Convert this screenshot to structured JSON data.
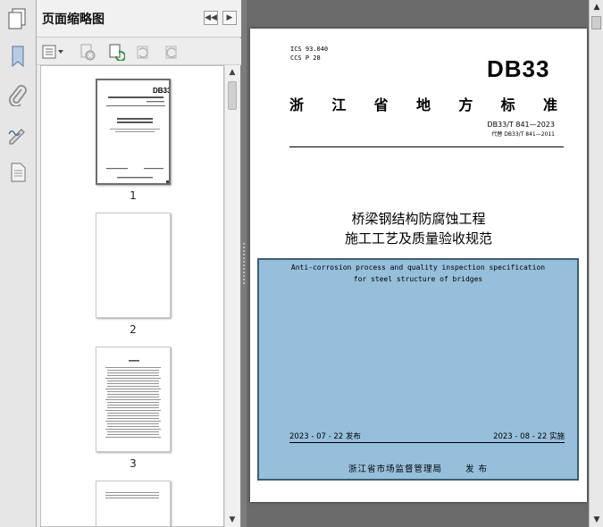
{
  "panel": {
    "title": "页面缩略图",
    "thumbnails": [
      {
        "label": "1"
      },
      {
        "label": "2"
      },
      {
        "label": "3"
      }
    ]
  },
  "document": {
    "ics_line1": "ICS 93.040",
    "ics_line2": "CCS P 28",
    "logo": "DB33",
    "org_chars": [
      "浙",
      "江",
      "省",
      "地",
      "方",
      "标",
      "准"
    ],
    "code": "DB33/T 841—2023",
    "replaces": "代替 DB33/T 841—2011",
    "title_line1": "桥梁钢结构防腐蚀工程",
    "title_line2": "施工工艺及质量验收规范",
    "en_line1": "Anti-corrosion process and quality inspection specification",
    "en_line2": "for steel structure of bridges",
    "issue_date": "2023 - 07 - 22 发布",
    "impl_date": "2023 - 08 - 22 实施",
    "publisher": "浙江省市场监督管理局",
    "publish_word": "发  布"
  },
  "colors": {
    "cover_block": "#96bfdb",
    "cover_border": "#3d5f72",
    "viewer_background": "#6b6b6b"
  }
}
